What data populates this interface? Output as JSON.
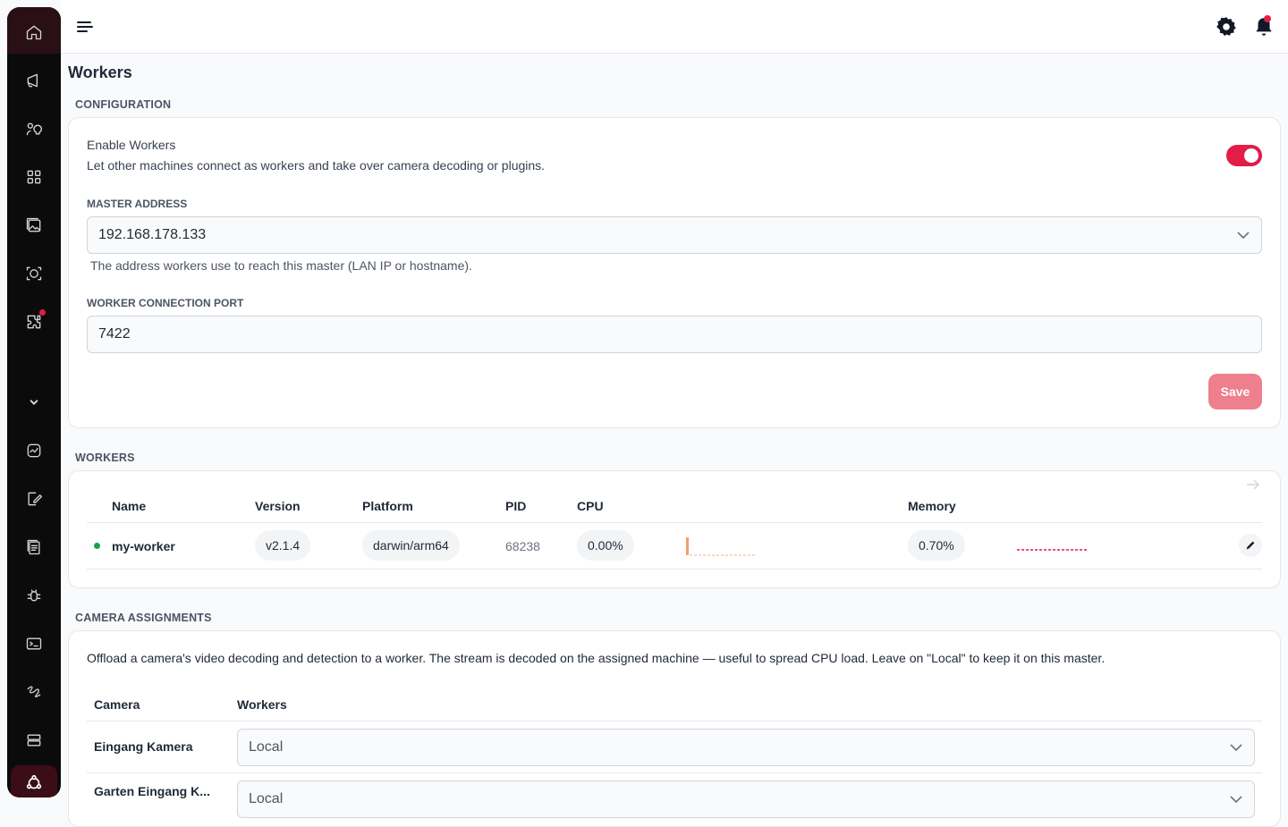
{
  "nav": {
    "items": [
      "home-icon",
      "megaphone-icon",
      "lightbulb-icon",
      "grid-icon",
      "gallery-icon",
      "camera-face-icon",
      "puzzle-icon",
      "chevron-down-icon",
      "activity-icon",
      "edit-file-icon",
      "document-icon",
      "bug-icon",
      "terminal-icon",
      "scribble-icon",
      "server-icon",
      "workers-icon"
    ],
    "accent": "#e11d48"
  },
  "page": {
    "title": "Workers"
  },
  "configuration": {
    "section_label": "CONFIGURATION",
    "enable_title": "Enable Workers",
    "enable_desc": "Let other machines connect as workers and take over camera decoding or plugins.",
    "enabled": true,
    "master_address_label": "MASTER ADDRESS",
    "master_address_value": "192.168.178.133",
    "master_address_hint": "The address workers use to reach this master (LAN IP or hostname).",
    "port_label": "WORKER CONNECTION PORT",
    "port_value": "7422",
    "save_label": "Save"
  },
  "workers": {
    "section_label": "WORKERS",
    "columns": {
      "name": "Name",
      "version": "Version",
      "platform": "Platform",
      "pid": "PID",
      "cpu": "CPU",
      "memory": "Memory"
    },
    "rows": [
      {
        "name": "my-worker",
        "version": "v2.1.4",
        "platform": "darwin/arm64",
        "pid": "68238",
        "cpu": "0.00%",
        "memory": "0.70%",
        "status": "online"
      }
    ]
  },
  "assignments": {
    "section_label": "CAMERA ASSIGNMENTS",
    "description": "Offload a camera's video decoding and detection to a worker. The stream is decoded on the assigned machine — useful to spread CPU load. Leave on \"Local\" to keep it on this master.",
    "columns": {
      "camera": "Camera",
      "workers": "Workers"
    },
    "rows": [
      {
        "camera": "Eingang Kamera",
        "worker": "Local"
      },
      {
        "camera": "Garten Eingang K...",
        "worker": "Local"
      }
    ]
  }
}
